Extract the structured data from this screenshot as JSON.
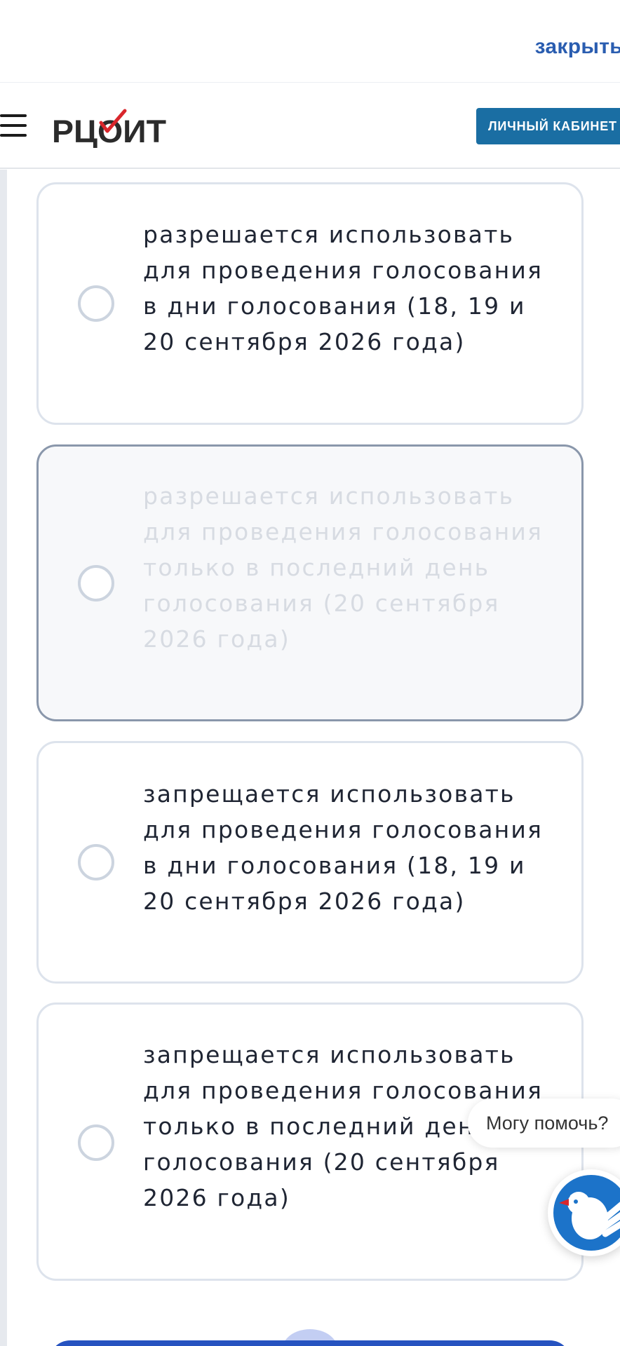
{
  "topbar": {
    "close_label": "закрыть"
  },
  "header": {
    "logo_text": "РЦОИТ",
    "cabinet_button": "ЛИЧНЫЙ КАБИНЕТ"
  },
  "options": [
    {
      "text": "разрешается использовать для проведения голосования в дни голосования (18, 19 и 20 сентября 2026 года)",
      "selected": false
    },
    {
      "text": "разрешается использовать для проведения голосования только в последний день голосования (20 сентября 2026 года)",
      "selected": true
    },
    {
      "text": "запрещается использовать для проведения голосования в дни голосования (18, 19 и 20 сентября 2026 года)",
      "selected": false
    },
    {
      "text": "запрещается использовать для проведения голосования только в последний день голосования (20 сентября 2026 года)",
      "selected": false
    }
  ],
  "assistant": {
    "bubble_text": "Могу помочь?"
  },
  "colors": {
    "link": "#2a5db0",
    "cabinet_button": "#1a6ea3",
    "logo_check": "#d9262c",
    "selected_border": "#8a97ab",
    "card_border": "#dde3ec",
    "primary_button": "#2653c0"
  },
  "icons": [
    "menu-icon",
    "radio-icon",
    "assistant-bird-icon"
  ]
}
